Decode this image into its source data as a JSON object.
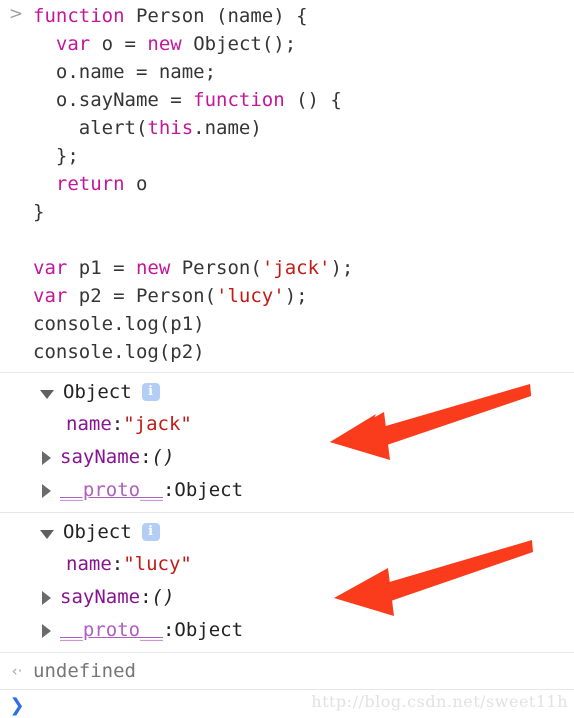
{
  "console": {
    "input_prompt_marker": ">",
    "code_lines": [
      [
        {
          "t": "function",
          "c": "kw"
        },
        {
          "t": " Person (name) {",
          "c": "plain"
        }
      ],
      [
        {
          "t": "  ",
          "c": "plain"
        },
        {
          "t": "var",
          "c": "kw"
        },
        {
          "t": " o = ",
          "c": "plain"
        },
        {
          "t": "new",
          "c": "kw"
        },
        {
          "t": " Object();",
          "c": "plain"
        }
      ],
      [
        {
          "t": "  o.name = name;",
          "c": "plain"
        }
      ],
      [
        {
          "t": "  o.sayName = ",
          "c": "plain"
        },
        {
          "t": "function",
          "c": "kw"
        },
        {
          "t": " () {",
          "c": "plain"
        }
      ],
      [
        {
          "t": "    alert(",
          "c": "plain"
        },
        {
          "t": "this",
          "c": "kw"
        },
        {
          "t": ".name)",
          "c": "plain"
        }
      ],
      [
        {
          "t": "  };",
          "c": "plain"
        }
      ],
      [
        {
          "t": "  ",
          "c": "plain"
        },
        {
          "t": "return",
          "c": "kw"
        },
        {
          "t": " o",
          "c": "plain"
        }
      ],
      [
        {
          "t": "}",
          "c": "plain"
        }
      ],
      [
        {
          "t": "",
          "c": "plain"
        }
      ],
      [
        {
          "t": "var",
          "c": "kw"
        },
        {
          "t": " p1 = ",
          "c": "plain"
        },
        {
          "t": "new",
          "c": "kw"
        },
        {
          "t": " Person(",
          "c": "plain"
        },
        {
          "t": "'jack'",
          "c": "str"
        },
        {
          "t": ");",
          "c": "plain"
        }
      ],
      [
        {
          "t": "var",
          "c": "kw"
        },
        {
          "t": " p2 = Person(",
          "c": "plain"
        },
        {
          "t": "'lucy'",
          "c": "str"
        },
        {
          "t": ");",
          "c": "plain"
        }
      ],
      [
        {
          "t": "console.log(p1)",
          "c": "plain"
        }
      ],
      [
        {
          "t": "console.log(p2)",
          "c": "plain"
        }
      ]
    ],
    "outputs": [
      {
        "label": "Object",
        "info_icon": "i",
        "expanded": true,
        "props": [
          {
            "name": "name",
            "sep": ": ",
            "value": "\"jack\"",
            "kind": "string",
            "expandable": false
          },
          {
            "name": "sayName",
            "sep": ": ",
            "value": "()",
            "kind": "function",
            "expandable": true
          },
          {
            "name": "__proto__",
            "sep": ": ",
            "value": "Object",
            "kind": "object",
            "expandable": true
          }
        ]
      },
      {
        "label": "Object",
        "info_icon": "i",
        "expanded": true,
        "props": [
          {
            "name": "name",
            "sep": ": ",
            "value": "\"lucy\"",
            "kind": "string",
            "expandable": false
          },
          {
            "name": "sayName",
            "sep": ": ",
            "value": "()",
            "kind": "function",
            "expandable": true
          },
          {
            "name": "__proto__",
            "sep": ": ",
            "value": "Object",
            "kind": "object",
            "expandable": true
          }
        ]
      }
    ],
    "return_value": {
      "marker": "‹·",
      "text": "undefined"
    },
    "live_prompt": {
      "caret": "❯",
      "value": "",
      "placeholder": ""
    }
  },
  "annotations": {
    "arrows": [
      {
        "name": "arrow-to-jack-name",
        "color": "#fa3b1c"
      },
      {
        "name": "arrow-to-lucy-name",
        "color": "#fa3b1c"
      }
    ]
  },
  "watermark": {
    "text": "http://blog.csdn.net/sweet11h"
  },
  "colors": {
    "keyword": "#c3179b",
    "string": "#c41a16",
    "property": "#881391",
    "proto": "#af5fbf",
    "arrow": "#fa3b1c",
    "info_badge": "#b3cdf4",
    "prompt_blue": "#2f6fe0"
  }
}
